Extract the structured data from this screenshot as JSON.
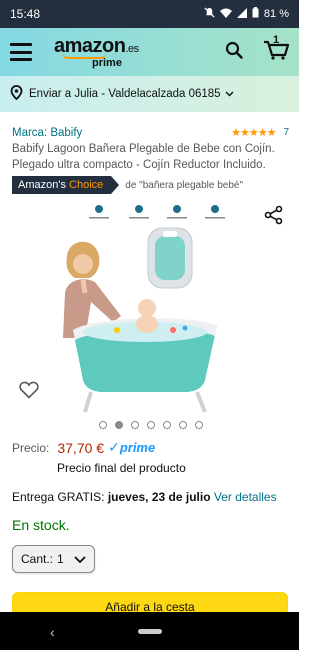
{
  "status_bar": {
    "time": "15:48",
    "battery": "81 %"
  },
  "header": {
    "logo": "amazon",
    "logo_tld": ".es",
    "logo_sub": "prime",
    "cart_count": "1"
  },
  "delivery": {
    "text": "Enviar a Julia - Valdelacalzada 06185"
  },
  "product": {
    "brand": "Marca: Babify",
    "rating_stars": 5,
    "rating_count": "7",
    "title": "Babify Lagoon Bañera Plegable de Bebe con Cojín. Plegado ultra compacto - Cojín Reductor Incluido.",
    "choice_prefix": "Amazon's ",
    "choice_accent": "Choice",
    "choice_query": "de \"bañera plegable bebé\"",
    "image_count": 7,
    "active_image": 1
  },
  "price": {
    "label": "Precio:",
    "value": "37,70 €",
    "prime": "prime",
    "note": "Precio final del producto"
  },
  "shipping": {
    "prefix": "Entrega GRATIS: ",
    "date": "jueves, 23 de julio",
    "link": "Ver detalles"
  },
  "stock": "En stock.",
  "quantity": {
    "label": "Cant.:",
    "value": "1"
  },
  "add_to_cart": "Añadir a la cesta",
  "colors": {
    "header_from": "#84d8e3",
    "header_to": "#a6e3c8",
    "link": "#007185",
    "price": "#b12704",
    "stock": "#007600",
    "button": "#ffd814"
  }
}
